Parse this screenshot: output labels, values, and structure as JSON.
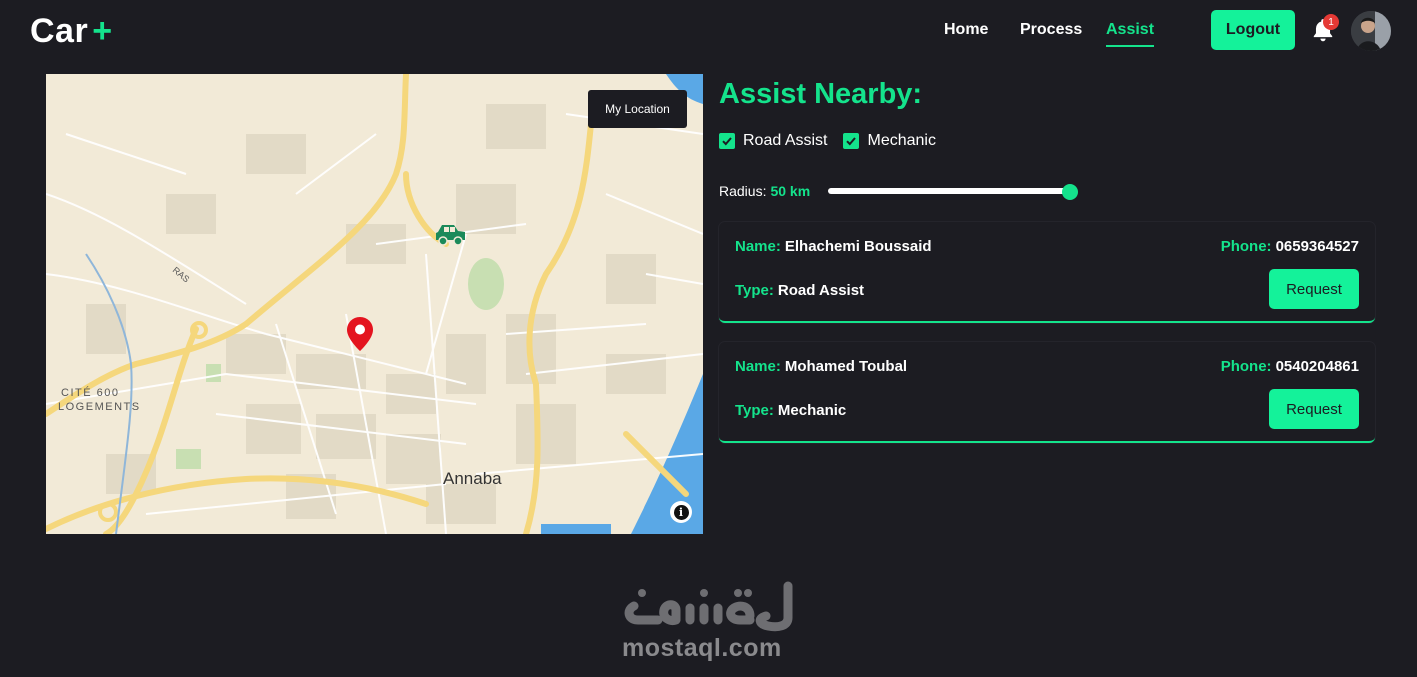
{
  "app": {
    "logo_text": "Car",
    "logo_plus": "+"
  },
  "nav": {
    "home": "Home",
    "process": "Process",
    "assist": "Assist",
    "active": "Assist"
  },
  "header": {
    "logout_label": "Logout",
    "notification_count": "1"
  },
  "map": {
    "my_location_label": "My Location",
    "labels": {
      "city": "Annaba",
      "district_line1": "CITÉ 600",
      "district_line2": "LOGEMENTS",
      "road": "RAS"
    }
  },
  "assist": {
    "heading": "Assist Nearby:",
    "filters": [
      {
        "label": "Road Assist",
        "checked": true
      },
      {
        "label": "Mechanic",
        "checked": true
      }
    ],
    "radius_label": "Radius:",
    "radius_value": "50 km",
    "radius_level": 1.0
  },
  "providers": [
    {
      "name_key": "Name:",
      "name": "Elhachemi Boussaid",
      "phone_key": "Phone:",
      "phone": "0659364527",
      "type_key": "Type:",
      "type": "Road Assist",
      "action": "Request"
    },
    {
      "name_key": "Name:",
      "name": "Mohamed Toubal",
      "phone_key": "Phone:",
      "phone": "0540204861",
      "type_key": "Type:",
      "type": "Mechanic",
      "action": "Request"
    }
  ],
  "watermark": {
    "arabic": "مستقل",
    "latin": "mostaql.com"
  },
  "colors": {
    "accent": "#14e38c",
    "button": "#14f29a",
    "background": "#1c1c22",
    "map_bg": "#f2ead7",
    "marker": "#e4141f"
  }
}
